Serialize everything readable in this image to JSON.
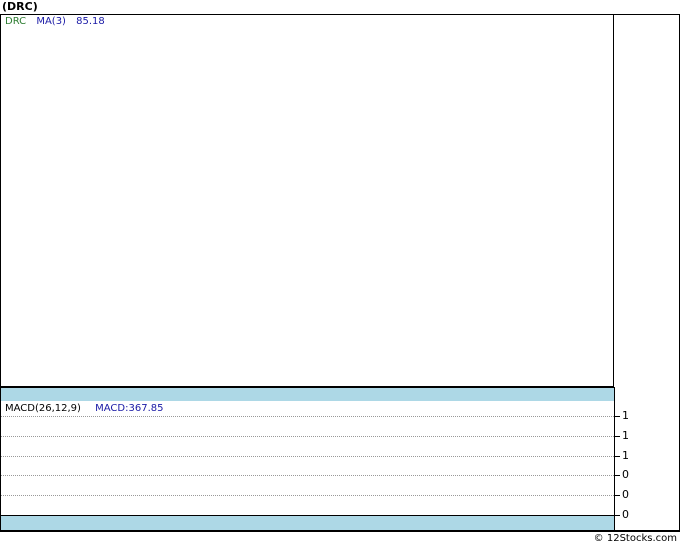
{
  "title": "(DRC)",
  "price_legend": {
    "ticker": "DRC",
    "ma_label": "MA(3)",
    "ma_value": "85.18"
  },
  "macd_legend": {
    "label": "MACD(26,12,9)",
    "value": "MACD:367.85"
  },
  "footer": "© 12Stocks.com",
  "colors": {
    "strip": "#add8e6",
    "ticker": "#2e7d32",
    "ma": "#1a1aa6",
    "grid": "#999999"
  },
  "chart_data": [
    {
      "type": "line",
      "title": "(DRC)",
      "series": [],
      "legend": [
        "DRC",
        "MA(3) 85.18"
      ]
    },
    {
      "type": "line",
      "title": "MACD(26,12,9)",
      "series": [],
      "legend": [
        "MACD:367.85"
      ],
      "y_ticks": [
        "1",
        "1",
        "1",
        "0",
        "0",
        "0"
      ],
      "grid": true
    }
  ]
}
